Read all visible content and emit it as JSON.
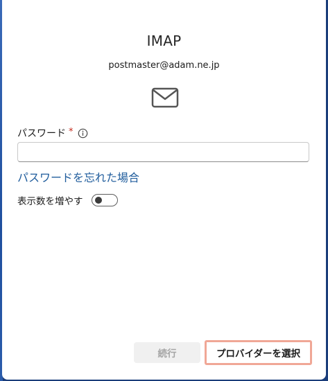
{
  "dialog": {
    "title": "IMAP",
    "email": "postmaster@adam.ne.jp",
    "password_label": "パスワード",
    "required_marker": "*",
    "password_value": "",
    "forgot_password_link": "パスワードを忘れた場合",
    "show_more_label": "表示数を増やす",
    "show_more_on": false,
    "continue_button": "続行",
    "choose_provider_button": "プロバイダーを選択"
  },
  "icons": {
    "mail": "mail-envelope-icon",
    "info": "info-icon"
  }
}
